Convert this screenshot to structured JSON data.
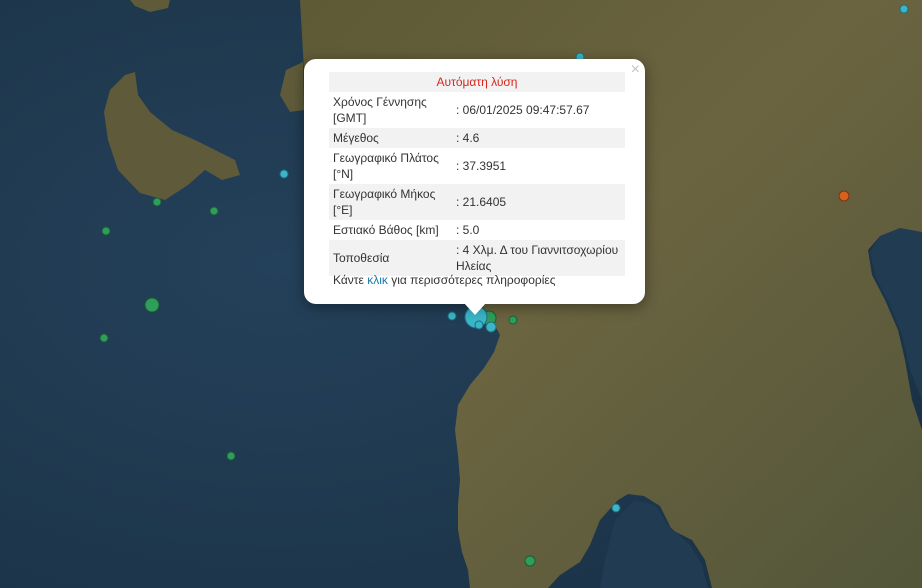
{
  "popup": {
    "heading": "Αυτόματη λύση",
    "close_symbol": "×",
    "rows": [
      {
        "label": "Χρόνος Γέννησης [GMT]",
        "value": ": 06/01/2025 09:47:57.67"
      },
      {
        "label": "Μέγεθος",
        "value": ": 4.6"
      },
      {
        "label": "Γεωγραφικό Πλάτος [°N]",
        "value": ": 37.3951"
      },
      {
        "label": "Γεωγραφικό Μήκος [°E]",
        "value": ": 21.6405"
      },
      {
        "label": "Εστιακό Βάθος [km]",
        "value": ": 5.0"
      },
      {
        "label": "Τοποθεσία",
        "value": ": 4 Χλμ. Δ του Γιαννιτσοχωρίου Ηλείας"
      }
    ],
    "more_prefix": "Κάντε ",
    "more_link": "κλικ",
    "more_suffix": " για περισσότερες πληροφορίες"
  },
  "colors": {
    "sea": "#213a50",
    "land": "#5b5a3a",
    "quake_recent": "#3ab5c9",
    "quake_older": "#2e9e5a",
    "quake_orange": "#d4621e"
  }
}
